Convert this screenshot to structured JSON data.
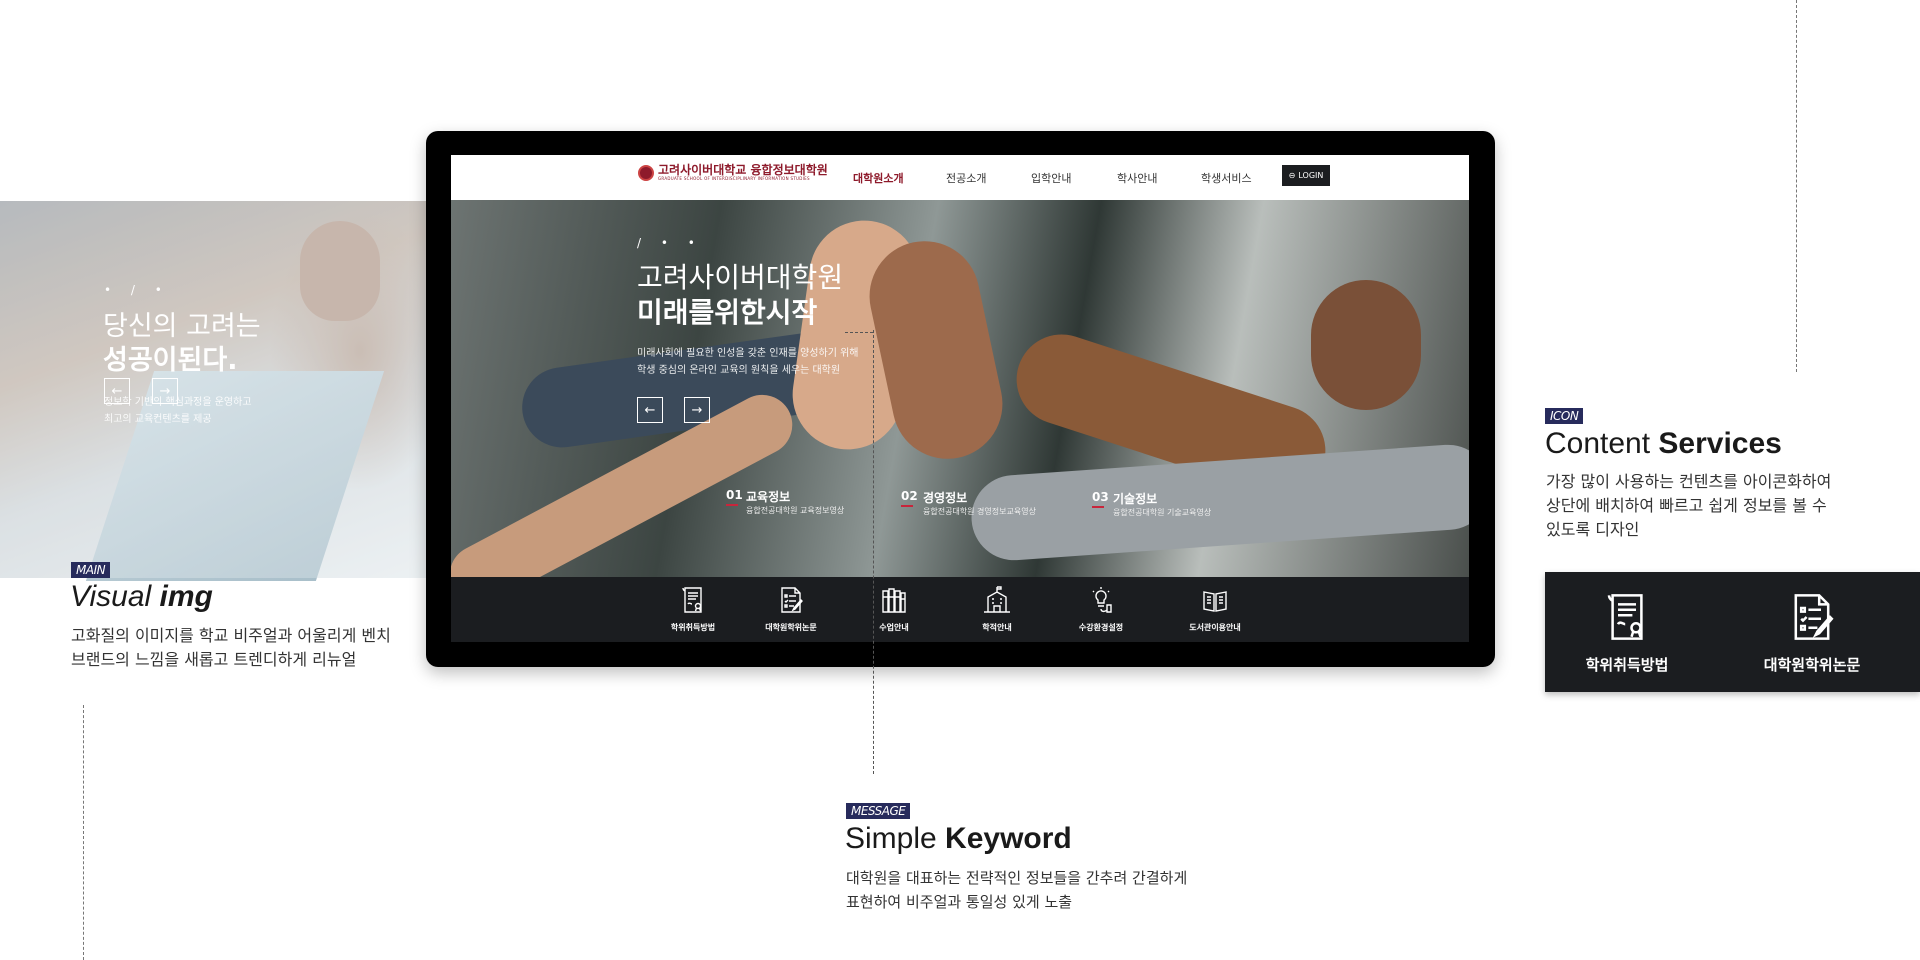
{
  "left_preview": {
    "dots": "• / •",
    "title_line1": "당신의 고려는",
    "title_line2": "성공이된다.",
    "desc_line1": "정보학 기반의 핵심과정을 운영하고",
    "desc_line2": "최고의 교육컨텐츠를 제공",
    "prev_arrow": "←",
    "next_arrow": "→"
  },
  "main_section": {
    "tag": "MAIN",
    "title_light": "Visual ",
    "title_bold": "img",
    "desc_line1": "고화질의 이미지를 학교 비주얼과 어울리게 벤치",
    "desc_line2": "브랜드의 느낌을 새롭고 트렌디하게 리뉴얼"
  },
  "site": {
    "logo_name": "고려사이버대학교 융합정보대학원",
    "logo_sub": "GRADUATE SCHOOL OF INTERDISCIPLINARY INFORMATION STUDIES",
    "nav": [
      "대학원소개",
      "전공소개",
      "입학안내",
      "학사안내",
      "학생서비스"
    ],
    "login_label": "LOGIN",
    "hero": {
      "dots": "/ • •",
      "title_line1": "고려사이버대학원",
      "title_line2": "미래를위한시작",
      "desc_line1": "미래사회에 필요한 인성을 갖춘 인재를 양성하기 위해",
      "desc_line2": "학생 중심의 온라인 교육의 원칙을 세우는 대학원",
      "prev_arrow": "←",
      "next_arrow": "→",
      "items": [
        {
          "num": "01",
          "title": "교육정보",
          "sub": "융합전공대학원  교육정보영상"
        },
        {
          "num": "02",
          "title": "경영정보",
          "sub": "융합전공대학원  경영정보교육영상"
        },
        {
          "num": "03",
          "title": "기술정보",
          "sub": "융합전공대학원  기술교육영상"
        }
      ]
    },
    "quick_icons": [
      {
        "label": "학위취득방법",
        "icon": "diploma-scroll-icon"
      },
      {
        "label": "대학원학위논문",
        "icon": "document-checklist-pen-icon"
      },
      {
        "label": "수업안내",
        "icon": "books-icon"
      },
      {
        "label": "학적안내",
        "icon": "school-building-icon"
      },
      {
        "label": "수강환경설정",
        "icon": "lightbulb-mouse-icon"
      },
      {
        "label": "도서관이용안내",
        "icon": "open-book-icon"
      }
    ]
  },
  "icon_section": {
    "tag": "ICON",
    "title_light": "Content ",
    "title_bold": "Services",
    "desc_line1": "가장 많이 사용하는 컨텐츠를 아이콘화하여",
    "desc_line2": "상단에 배치하여  빠르고 쉽게 정보를 볼 수",
    "desc_line3": "있도록 디자인",
    "samples": [
      {
        "label": "학위취득방법",
        "icon": "diploma-scroll-icon"
      },
      {
        "label": "대학원학위논문",
        "icon": "document-checklist-pen-icon"
      }
    ]
  },
  "message_section": {
    "tag": "MESSAGE",
    "title_light": "Simple ",
    "title_bold": "Keyword",
    "desc_line1": "대학원을 대표하는 전략적인 정보들을 간추려 간결하게",
    "desc_line2": "표현하여 비주얼과 통일성 있게 노출"
  },
  "colors": {
    "brand": "#8e1a2b",
    "tag_bg": "#272b5c",
    "dark": "#1b1d20",
    "accent_underline": "#c8253b"
  }
}
